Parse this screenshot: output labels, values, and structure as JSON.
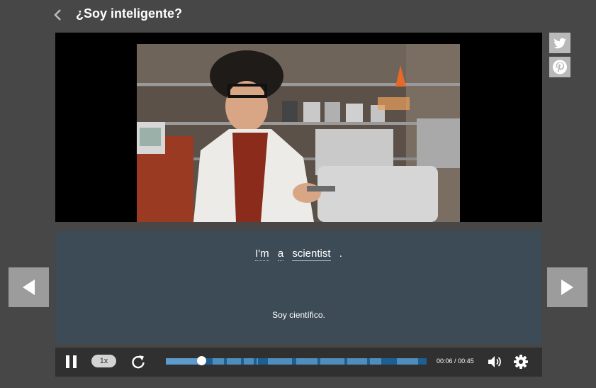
{
  "header": {
    "title": "¿Soy inteligente?"
  },
  "caption": {
    "words": [
      "I'm",
      "a",
      "scientist"
    ],
    "punctuation": ".",
    "translation": "Soy científico."
  },
  "player": {
    "speed": "1x",
    "current_time": "00:06",
    "separator": "/",
    "duration": "00:45",
    "progress_fraction": 0.135
  },
  "icons": {
    "back": "chevron-left-icon",
    "twitter": "twitter-icon",
    "pinterest": "pinterest-icon",
    "prev": "triangle-left-icon",
    "next": "triangle-right-icon",
    "pause": "pause-icon",
    "replay": "replay-icon",
    "volume": "volume-icon",
    "settings": "gear-icon"
  },
  "colors": {
    "background": "#474747",
    "caption_panel": "#3c4b55",
    "progress": "#1d5f93",
    "controls": "#303030"
  }
}
